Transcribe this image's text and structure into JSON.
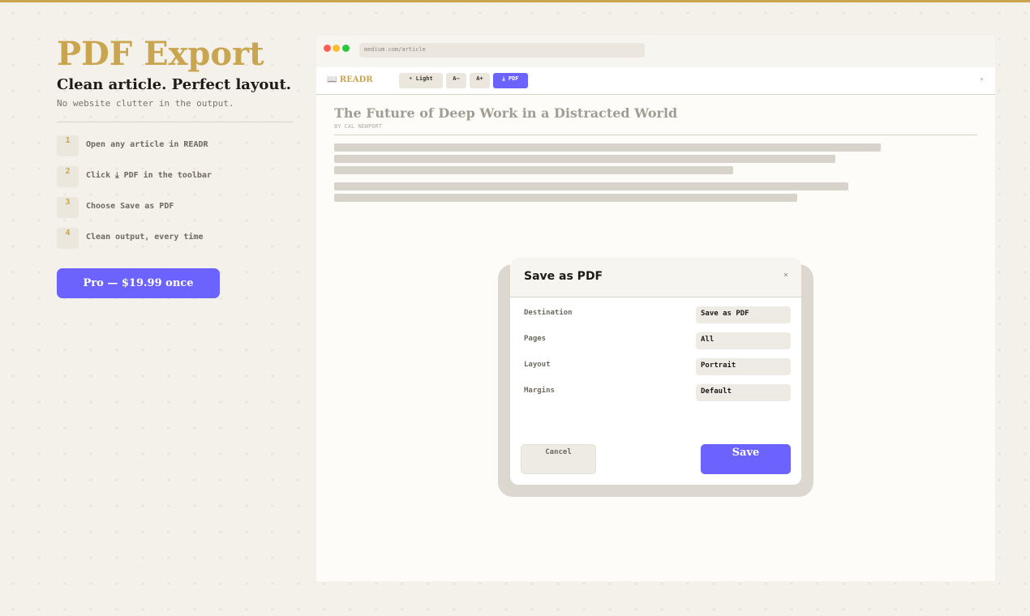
{
  "hero": {
    "title": "PDF Export",
    "subtitle": "Clean article. Perfect layout.",
    "note": "No website clutter in the output."
  },
  "steps": [
    {
      "num": "1",
      "text": "Open any article in READR"
    },
    {
      "num": "2",
      "text": "Click ⤓ PDF in the toolbar"
    },
    {
      "num": "3",
      "text": "Choose Save as PDF"
    },
    {
      "num": "4",
      "text": "Clean output, every time"
    }
  ],
  "pro_button": "Pro — $19.99 once",
  "browser": {
    "url": "medium.com/article",
    "brand": "📖 READR",
    "toolbar": {
      "light": "☀ Light",
      "aminus": "A−",
      "aplus": "A+",
      "pdf": "⤓ PDF",
      "close": "×"
    }
  },
  "article": {
    "title": "The Future of Deep Work in a Distracted World",
    "byline": "BY CAL NEWPORT"
  },
  "dialog": {
    "title": "Save as PDF",
    "close": "×",
    "fields": [
      {
        "label": "Destination",
        "value": "Save as PDF"
      },
      {
        "label": "Pages",
        "value": "All"
      },
      {
        "label": "Layout",
        "value": "Portrait"
      },
      {
        "label": "Margins",
        "value": "Default"
      }
    ],
    "cancel": "Cancel",
    "save": "Save"
  },
  "colors": {
    "accent": "#c9a550",
    "primary": "#6c63ff",
    "background": "#f4f1ea"
  },
  "icons": {
    "light_toggle": "sun-icon",
    "pdf_export": "download-icon",
    "brand": "book-icon",
    "close": "close-icon"
  }
}
